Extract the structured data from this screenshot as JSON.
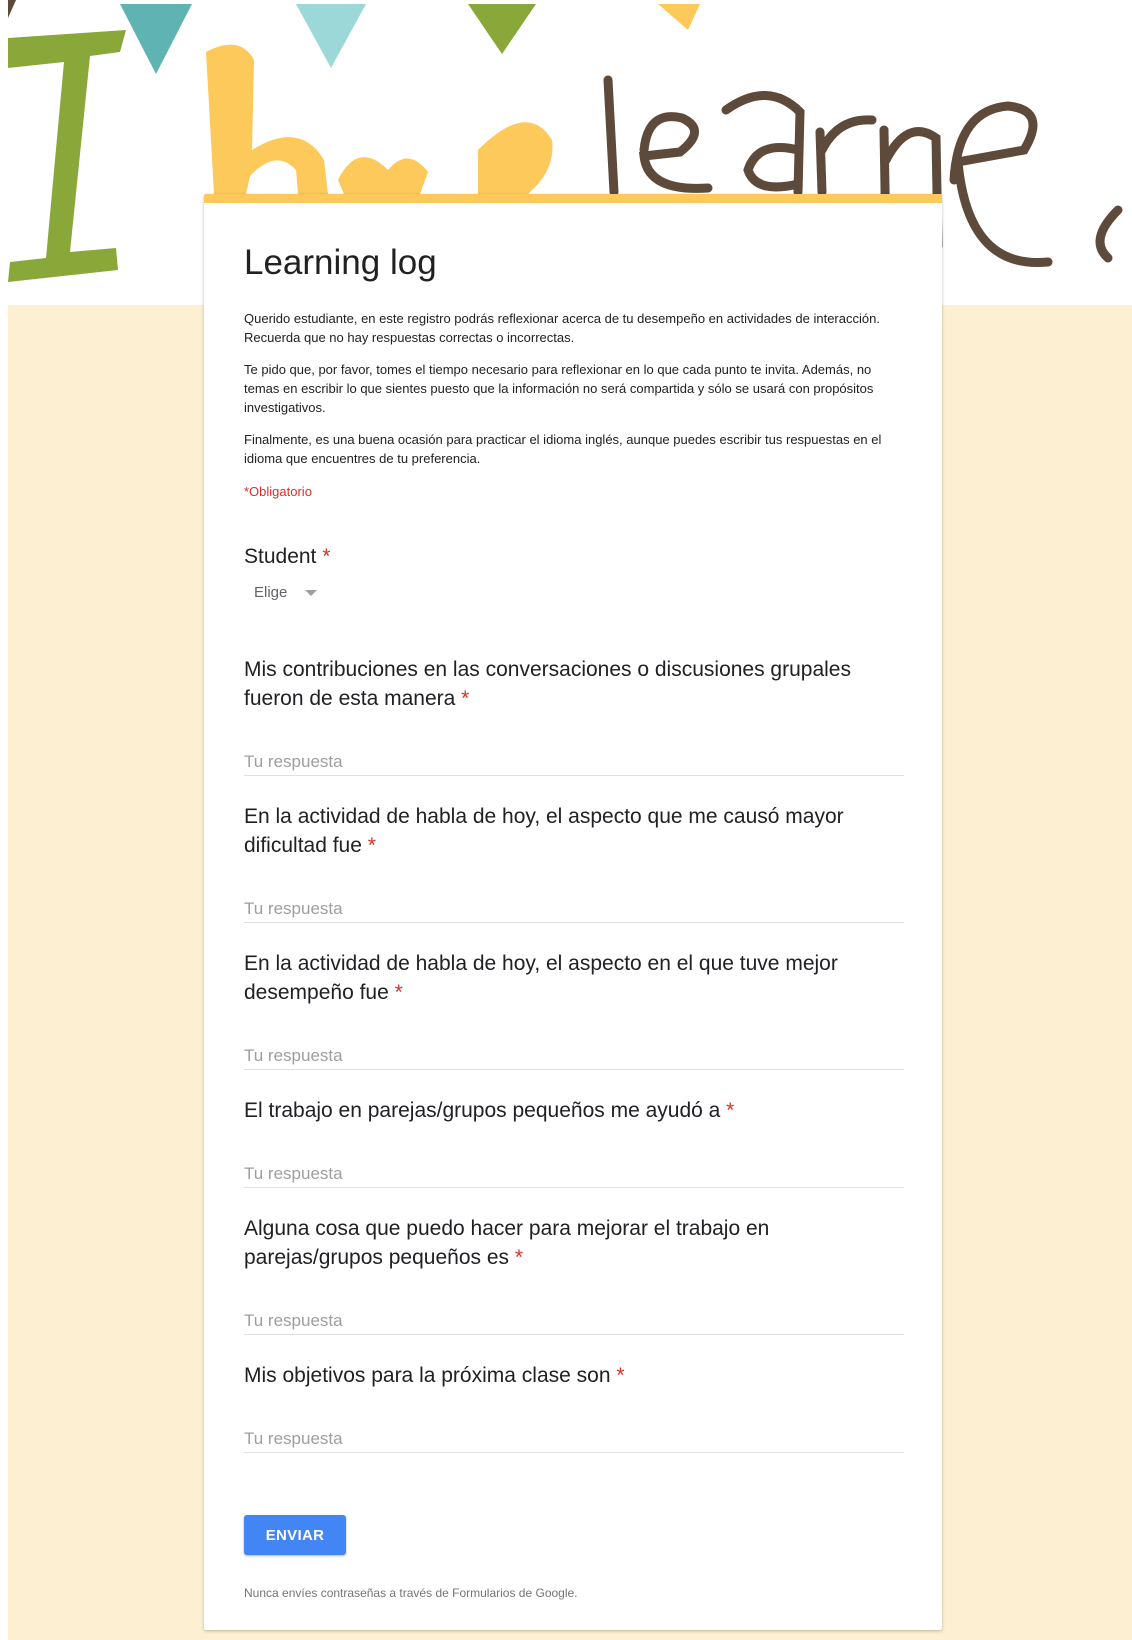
{
  "colors": {
    "page_background": "#fdefd2",
    "accent_bar": "#fcc95a",
    "required": "#d93025",
    "submit_button": "#4285f4"
  },
  "banner": {
    "text": "I have learned",
    "flag_colors": [
      "#5fb3b3",
      "#9dd8d8",
      "#8aa83a",
      "#fcc95a"
    ]
  },
  "form": {
    "title": "Learning log",
    "description": [
      "Querido estudiante, en este registro podrás reflexionar acerca de tu desempeño en actividades de interacción. Recuerda que no hay respuestas correctas o incorrectas.",
      "Te pido que, por favor, tomes el tiempo necesario para reflexionar en lo que cada punto te invita. Además, no temas en escribir lo que sientes puesto que la información no será compartida y sólo se usará con propósitos investigativos.",
      "Finalmente, es una buena ocasión para practicar el idioma inglés, aunque puedes escribir tus respuestas en el idioma que encuentres de tu preferencia."
    ],
    "required_note": "*Obligatorio",
    "required_marker": "*",
    "student": {
      "label": "Student",
      "dropdown_value": "Elige"
    },
    "questions": [
      {
        "label": "Mis contribuciones en las conversaciones o discusiones grupales fueron de esta manera",
        "placeholder": "Tu respuesta"
      },
      {
        "label": "En la actividad de habla de hoy, el aspecto que me causó mayor dificultad fue",
        "placeholder": "Tu respuesta"
      },
      {
        "label": "En la actividad de habla de hoy, el aspecto en el que tuve mejor desempeño fue",
        "placeholder": "Tu respuesta"
      },
      {
        "label": "El trabajo en parejas/grupos pequeños me ayudó a",
        "placeholder": "Tu respuesta"
      },
      {
        "label": "Alguna cosa que puedo hacer para mejorar el trabajo en parejas/grupos pequeños es",
        "placeholder": "Tu respuesta"
      },
      {
        "label": "Mis objetivos para la próxima clase son",
        "placeholder": "Tu respuesta"
      }
    ],
    "submit_label": "ENVIAR",
    "footer_note": "Nunca envíes contraseñas a través de Formularios de Google."
  }
}
